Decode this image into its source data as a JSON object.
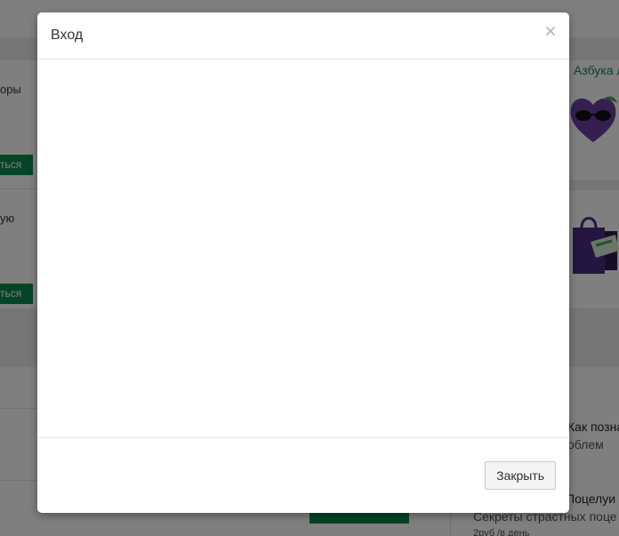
{
  "background": {
    "card1": {
      "text": "оры",
      "button": "ться"
    },
    "card2": {
      "text": "ую",
      "button": "ться"
    },
    "promo": {
      "link_text": "Азбука Л",
      "icons": [
        "heart-sunglasses-icon",
        "shopping-bag-icon"
      ]
    },
    "articles": [
      {
        "title": "Как позна",
        "subtitle": "облем",
        "meta": ""
      },
      {
        "title": "Поцелуи",
        "subtitle": "Секреты страстных поце",
        "meta": "2руб /в день"
      }
    ],
    "colors": {
      "brand_green": "#0a8a4e",
      "band_gray": "#ececec"
    }
  },
  "modal": {
    "title": "Вход",
    "close_icon": "close-icon",
    "close_button_label": "Закрыть"
  }
}
